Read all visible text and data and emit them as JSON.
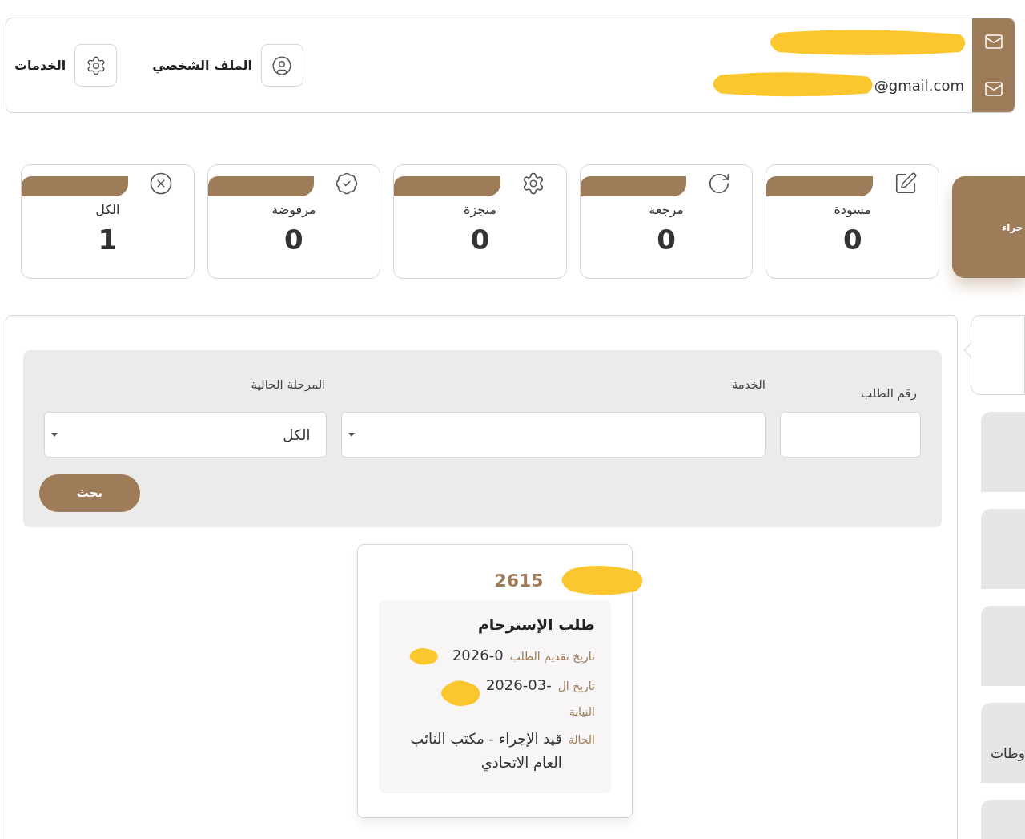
{
  "header": {
    "nav": [
      {
        "kind": "profile",
        "label": "الملف الشخصي"
      },
      {
        "kind": "services",
        "label": "الخدمات"
      }
    ],
    "contacts": [
      {
        "kind": "redacted"
      },
      {
        "kind": "email",
        "text": "@gmail.com"
      }
    ]
  },
  "side_tab": {
    "label": "جراء"
  },
  "stats": [
    {
      "kind": "draft",
      "label": "مسودة",
      "count": "0"
    },
    {
      "kind": "returned",
      "label": "مرجعة",
      "count": "0"
    },
    {
      "kind": "done",
      "label": "منجزة",
      "count": "0"
    },
    {
      "kind": "rejected",
      "label": "مرفوضة",
      "count": "0"
    },
    {
      "kind": "all",
      "label": "الكل",
      "count": "1"
    }
  ],
  "sidebar": {
    "items": [
      {
        "kind": "blank"
      },
      {
        "kind": "blank"
      },
      {
        "kind": "blank"
      },
      {
        "kind": "labeled",
        "label": "وطات"
      },
      {
        "kind": "blank"
      }
    ]
  },
  "filters": {
    "request_number": {
      "label": "رقم الطلب"
    },
    "service": {
      "label": "الخدمة"
    },
    "stage": {
      "label": "المرحلة الحالية",
      "value": "الكل"
    },
    "search_button": "بحث"
  },
  "result": {
    "number": "2615",
    "title": "طلب الإسترحام",
    "fields": [
      {
        "label": "تاريخ تقديم الطلب",
        "value": "2026-0"
      },
      {
        "label": "تاريخ ال",
        "value": "2026-03-"
      },
      {
        "label": "النيابة"
      }
    ],
    "status": {
      "label": "الحالة",
      "value": "قيد الإجراء - مكتب النائب العام الاتحادي"
    }
  }
}
